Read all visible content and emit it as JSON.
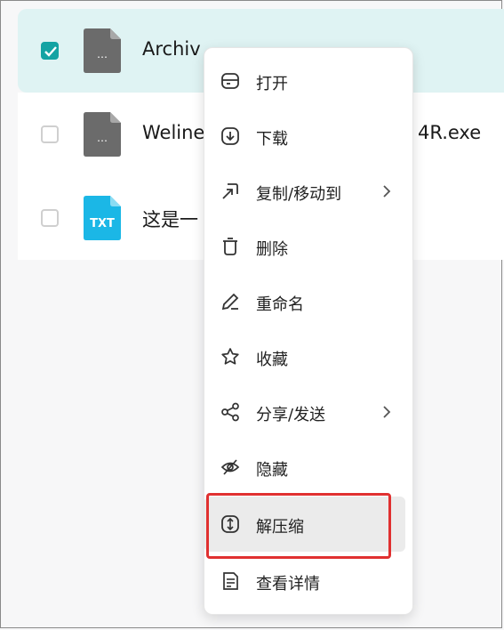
{
  "files": [
    {
      "name": "Archiv",
      "checked": true,
      "type": "unknown",
      "type_label": "…"
    },
    {
      "name": "Weline",
      "name_tail": "4R.exe",
      "checked": false,
      "type": "unknown",
      "type_label": "…"
    },
    {
      "name": "这是一",
      "checked": false,
      "type": "txt",
      "type_label": "TXT"
    }
  ],
  "context_menu": {
    "items": [
      {
        "label": "打开",
        "icon": "open-icon",
        "submenu": false
      },
      {
        "label": "下载",
        "icon": "download-icon",
        "submenu": false
      },
      {
        "label": "复制/移动到",
        "icon": "copy-move-icon",
        "submenu": true
      },
      {
        "label": "删除",
        "icon": "trash-icon",
        "submenu": false
      },
      {
        "label": "重命名",
        "icon": "pencil-icon",
        "submenu": false
      },
      {
        "label": "收藏",
        "icon": "star-icon",
        "submenu": false
      },
      {
        "label": "分享/发送",
        "icon": "share-icon",
        "submenu": true
      },
      {
        "label": "隐藏",
        "icon": "eye-off-icon",
        "submenu": false
      },
      {
        "label": "解压缩",
        "icon": "extract-icon",
        "submenu": false,
        "hovered": true,
        "highlighted": true
      },
      {
        "label": "查看详情",
        "icon": "details-icon",
        "submenu": false
      }
    ]
  },
  "colors": {
    "accent": "#14a3a3",
    "selected_row": "#dff3f3",
    "txt_icon": "#1bb7e6",
    "generic_file_icon": "#6b6b6b",
    "highlight": "#e03030"
  }
}
